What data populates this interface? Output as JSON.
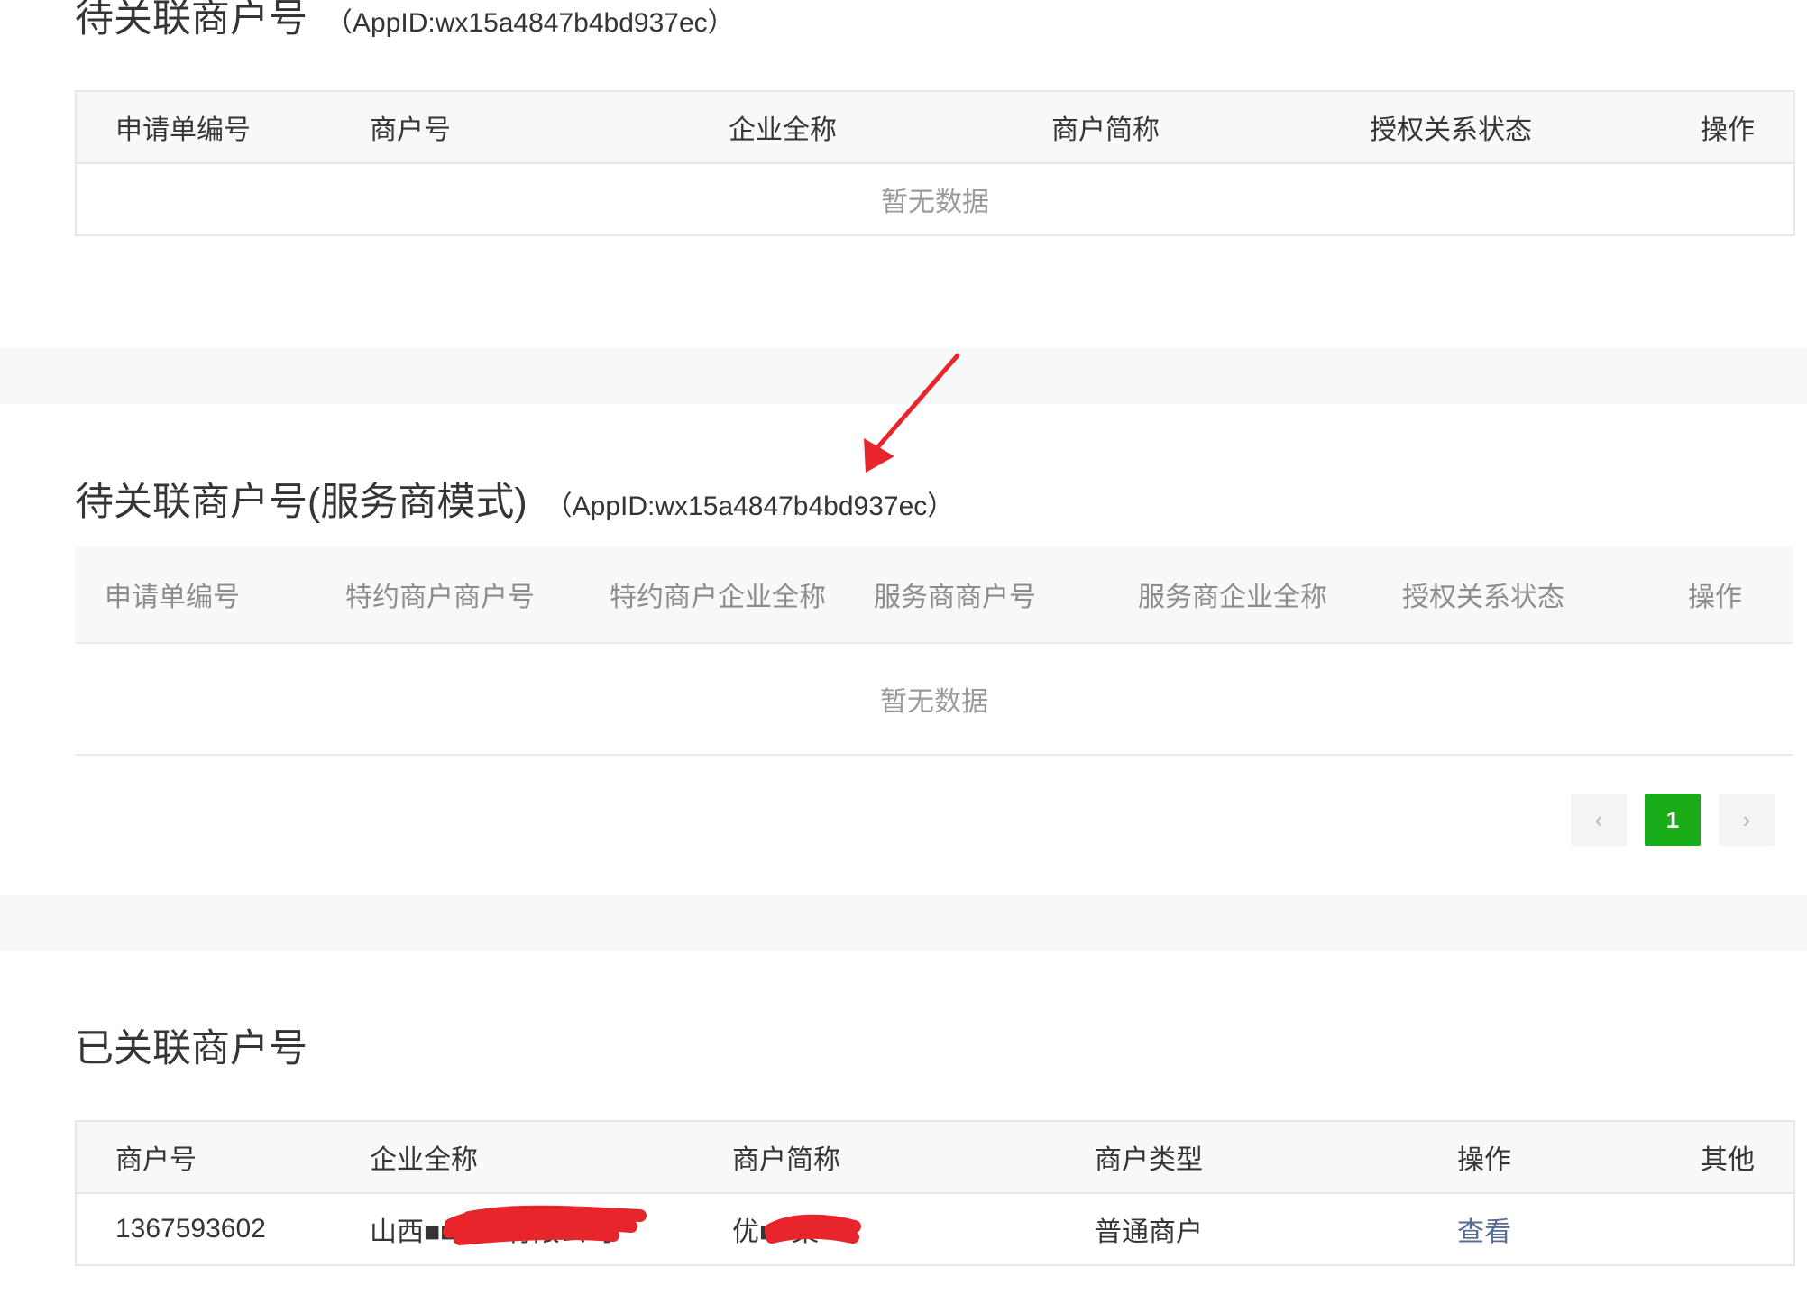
{
  "section1": {
    "title": "待关联商户号",
    "appid": "（AppID:wx15a4847b4bd937ec）",
    "columns": [
      "申请单编号",
      "商户号",
      "企业全称",
      "商户简称",
      "授权关系状态",
      "操作"
    ],
    "empty_text": "暂无数据"
  },
  "section2": {
    "title": "待关联商户号(服务商模式)",
    "appid": "（AppID:wx15a4847b4bd937ec）",
    "columns": [
      "申请单编号",
      "特约商户商户号",
      "特约商户企业全称",
      "服务商商户号",
      "服务商企业全称",
      "授权关系状态",
      "操作"
    ],
    "empty_text": "暂无数据",
    "pagination": {
      "prev": "‹",
      "current": "1",
      "next": "›"
    }
  },
  "section3": {
    "title": "已关联商户号",
    "columns": [
      "商户号",
      "企业全称",
      "商户简称",
      "商户类型",
      "操作",
      "其他"
    ],
    "rows": [
      {
        "merchant_id": "1367593602",
        "company_name": "山西■■■■■有限公司",
        "short_name": "优■■集",
        "type": "普通商户",
        "action": "查看",
        "other": ""
      }
    ]
  },
  "colors": {
    "accent_green": "#1aad19",
    "link": "#576b95",
    "annotation_red": "#e8252a"
  }
}
